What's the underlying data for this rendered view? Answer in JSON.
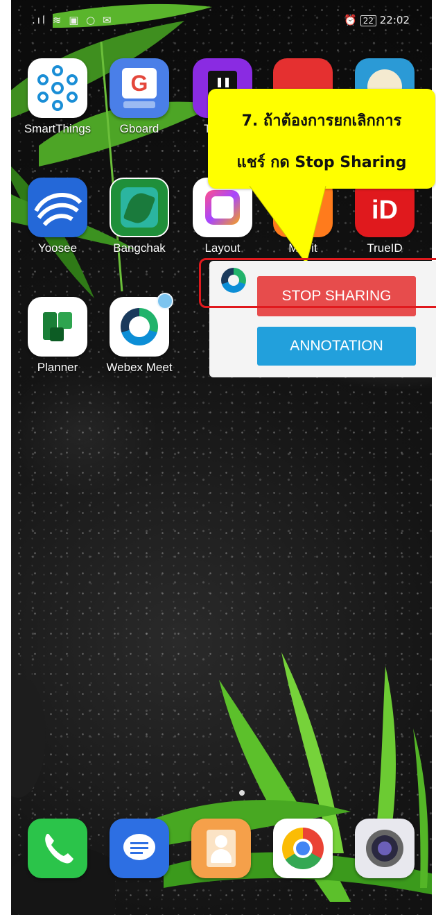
{
  "status_bar": {
    "left_icons": ".ıl ≋ ▣ ○ ✉",
    "time": "22:02",
    "battery": "22",
    "alarm_icon": "alarm-icon"
  },
  "apps": {
    "row1": [
      {
        "label": "SmartThings",
        "icon": "smartthings-icon"
      },
      {
        "label": "Gboard",
        "icon": "gboard-icon"
      },
      {
        "label": "T",
        "icon": "twitch-icon"
      },
      {
        "label": "",
        "icon": "jd-icon"
      },
      {
        "label": "",
        "icon": "clock-app-icon"
      }
    ],
    "row2": [
      {
        "label": "Yoosee",
        "icon": "yoosee-icon"
      },
      {
        "label": "Bangchak",
        "icon": "bangchak-icon"
      },
      {
        "label": "Layout",
        "icon": "layout-icon"
      },
      {
        "label": "Mi Fit",
        "icon": "mifit-icon"
      },
      {
        "label": "TrueID",
        "icon": "trueid-icon"
      }
    ],
    "row3": [
      {
        "label": "Planner",
        "icon": "planner-icon"
      },
      {
        "label": "Webex Meet",
        "icon": "webex-icon"
      }
    ]
  },
  "dock": [
    {
      "icon": "phone-icon"
    },
    {
      "icon": "messages-icon"
    },
    {
      "icon": "contacts-icon"
    },
    {
      "icon": "chrome-icon"
    },
    {
      "icon": "camera-icon"
    }
  ],
  "callout": {
    "line1": "7. ถ้าต้องการยกเลิกการ",
    "line2": "แชร์ กด Stop Sharing"
  },
  "share_panel": {
    "stop_label": "STOP SHARING",
    "annotation_label": "ANNOTATION"
  },
  "colors": {
    "callout_bg": "#ffff00",
    "stop_btn": "#e74c4c",
    "annotation_btn": "#22a0dc",
    "highlight": "#e0191d"
  }
}
